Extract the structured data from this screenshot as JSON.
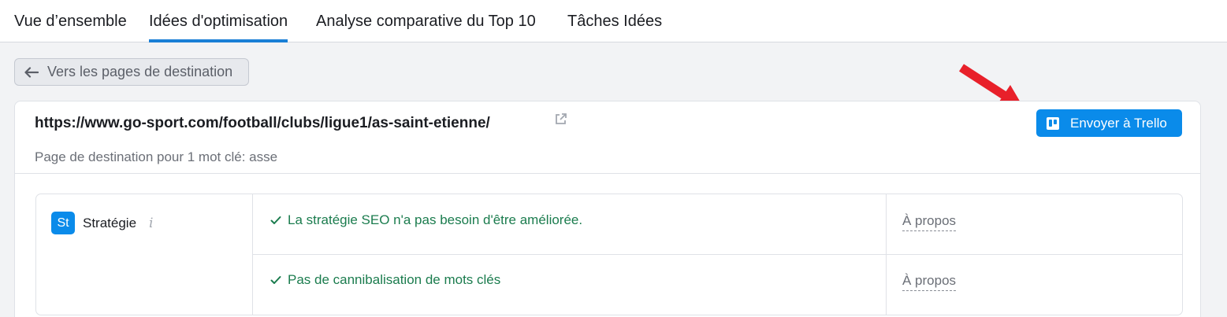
{
  "tabs": [
    {
      "label": "Vue d’ensemble",
      "active": false
    },
    {
      "label": "Idées d'optimisation",
      "active": true
    },
    {
      "label": "Analyse comparative du Top 10",
      "active": false
    },
    {
      "label": "Tâches Idées",
      "active": false
    }
  ],
  "back_button": {
    "label": "Vers les pages de destination",
    "icon": "arrow-left-icon"
  },
  "page": {
    "url": "https://www.go-sport.com/football/clubs/ligue1/as-saint-etienne/",
    "subtitle": "Page de destination pour 1 mot clé: asse"
  },
  "trello_button": {
    "label": "Envoyer à Trello",
    "icon": "trello-icon"
  },
  "category": {
    "badge": "St",
    "label": "Stratégie",
    "info_icon": "i"
  },
  "ideas": [
    {
      "text": "La stratégie SEO n'a pas besoin d'être améliorée.",
      "link": "À propos"
    },
    {
      "text": "Pas de cannibalisation de mots clés",
      "link": "À propos"
    }
  ],
  "colors": {
    "accent": "#0a8bea",
    "tab_underline": "#1a7fd6",
    "success_text": "#1b7c4e",
    "annotation_arrow": "#e8202a"
  }
}
